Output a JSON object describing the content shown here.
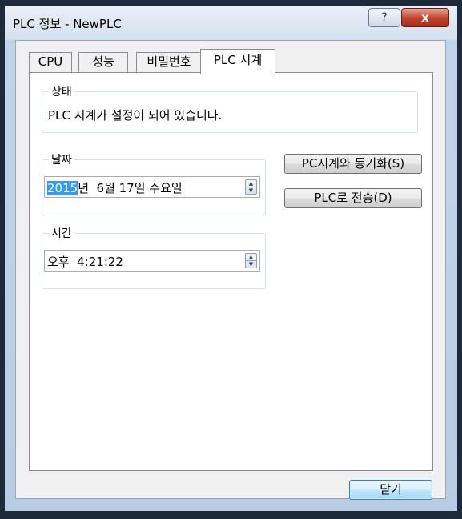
{
  "window": {
    "title": "PLC 정보 - NewPLC",
    "help": "?",
    "close": "x"
  },
  "tabs": [
    {
      "label": "CPU"
    },
    {
      "label": "성능"
    },
    {
      "label": "비밀번호"
    },
    {
      "label": "PLC 시계",
      "active": true
    }
  ],
  "status_group": {
    "label": "상태",
    "text": "PLC 시계가 설정이 되어 있습니다."
  },
  "date_group": {
    "label": "날짜",
    "year_selected": "2015",
    "rest": "년  6월 17일 수요일"
  },
  "time_group": {
    "label": "시간",
    "value": "오후  4:21:22"
  },
  "buttons": {
    "sync_pc": "PC시계와 동기화(S)",
    "send_plc": "PLC로 전송(D)",
    "close": "닫기"
  }
}
